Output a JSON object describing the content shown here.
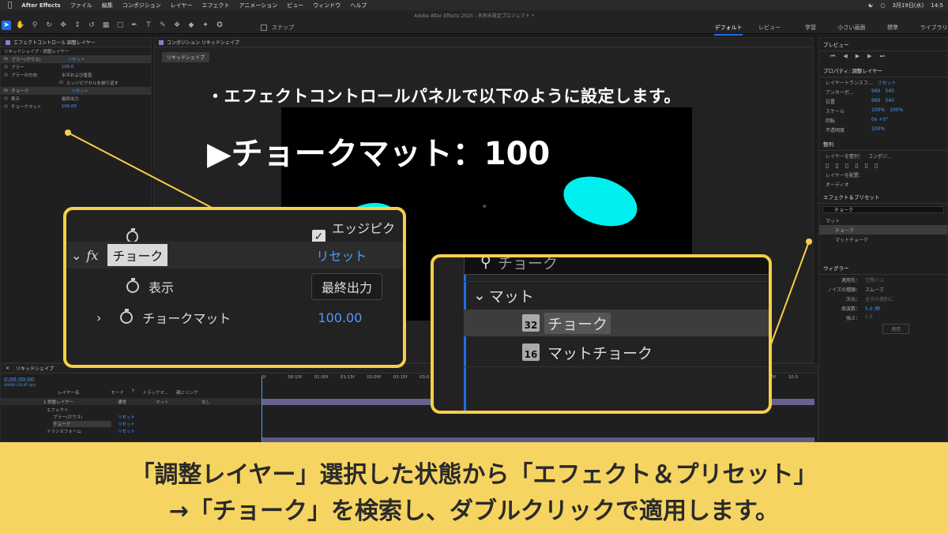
{
  "menubar": {
    "app": "After Effects",
    "items": [
      "ファイル",
      "編集",
      "コンポジション",
      "レイヤー",
      "エフェクト",
      "アニメーション",
      "ビュー",
      "ウィンドウ",
      "ヘルプ"
    ],
    "date": "3月19日(水)",
    "time": "14:5"
  },
  "window_title": "Adobe After Effects 2025 - 名称未設定プロジェクト *",
  "snap_label": "スナップ",
  "workspaces": [
    "デフォルト",
    "レビュー",
    "学習",
    "小さい画面",
    "標準",
    "ライブラリ"
  ],
  "effect_controls": {
    "tab": "エフェクトコントロール 調整レイヤー",
    "path": "リキッドシェイプ・調整レイヤー",
    "rows": [
      {
        "label": "ブラー(ガウス)",
        "value": "リセット"
      },
      {
        "label": "ブラー",
        "value": "100.0"
      },
      {
        "label": "ブラーの方向",
        "value": "水平および垂直"
      },
      {
        "label": "エッジピクセルを繰り返す",
        "value": ""
      },
      {
        "label": "チョーク",
        "value": "リセット"
      },
      {
        "label": "表示",
        "value": "最終出力"
      },
      {
        "label": "チョークマット",
        "value": "100.00"
      }
    ]
  },
  "composition": {
    "tab": "コンポジション リキッドシェイプ",
    "chip": "リキッドシェイプ"
  },
  "captions": {
    "top": "・エフェクトコントロールパネルで以下のように設定します。",
    "main": "▶チョークマット：100"
  },
  "zoom_effects": {
    "edge_pixels": "エッジピクセ",
    "fx": "fx",
    "choke": "チョーク",
    "reset": "リセット",
    "view": "表示",
    "view_value": "最終出力",
    "choke_matte": "チョークマット",
    "choke_matte_value": "100.00"
  },
  "zoom_presets": {
    "search": "チョーク",
    "group": "マット",
    "item1_badge": "32",
    "item1": "チョーク",
    "item2_badge": "16",
    "item2": "マットチョーク"
  },
  "right_panel": {
    "preview_title": "プレビュー",
    "props_title": "プロパティ: 調整レイヤー",
    "layer_transform": "レイヤートランスフ...",
    "reset": "リセット",
    "props": [
      {
        "label": "アンカーポ...",
        "v1": "960",
        "v2": "540"
      },
      {
        "label": "位置",
        "v1": "960",
        "v2": "540"
      },
      {
        "label": "スケール",
        "v1": "100%",
        "v2": "100%"
      },
      {
        "label": "回転",
        "v1": "0x +0°",
        "v2": ""
      },
      {
        "label": "不透明度",
        "v1": "100%",
        "v2": ""
      }
    ],
    "align_title": "整列",
    "align_to": "レイヤーを整列：",
    "align_to_value": "コンポジ...",
    "distribute": "レイヤーを配置：",
    "distribute_value": "オーディオ",
    "effects_title": "エフェクト＆プリセット",
    "search": "チョーク",
    "tree_group": "マット",
    "tree_item1": "チョーク",
    "tree_item2": "マットチョーク",
    "wiggler_title": "ウィグラー",
    "wiggler_rows": [
      {
        "label": "適用先：",
        "value": "空間パス"
      },
      {
        "label": "ノイズの種類：",
        "value": "スムーズ"
      },
      {
        "label": "次元：",
        "value": "全次元個別に"
      },
      {
        "label": "周波数：",
        "value": "5.0 /秒"
      },
      {
        "label": "強さ：",
        "value": "1.0"
      }
    ],
    "apply": "適用"
  },
  "timeline": {
    "tab": "リキッドシェイプ",
    "timecode": "0;00;00;00",
    "timecode_sub": "00000 (29.97 fps)",
    "cols": [
      "レイヤー名",
      "モード",
      "T",
      "トラックマ...",
      "親とリンク"
    ],
    "ruler": [
      "0f",
      "00:15f",
      "01:00f",
      "01:15f",
      "02:00f",
      "02:15f",
      "03:0",
      "09:15f",
      "10:0"
    ],
    "rows": [
      {
        "name": "1  調整レイヤー",
        "mode": "通常",
        "track": "マット",
        "parent": "なし"
      },
      {
        "name": "エフェクト",
        "mode": "",
        "track": "",
        "parent": ""
      },
      {
        "name": "ブラー(ガウス)",
        "mode": "リセット",
        "track": "",
        "parent": ""
      },
      {
        "name": "チョーク",
        "mode": "リセット",
        "track": "",
        "parent": ""
      },
      {
        "name": "トランスフォーム",
        "mode": "リセット",
        "track": "",
        "parent": ""
      }
    ]
  },
  "banner": {
    "line1": "「調整レイヤー」選択した状態から「エフェクト＆プリセット」",
    "line2": "→「チョーク」を検索し、ダブルクリックで適用します。"
  },
  "colors": {
    "highlight": "#f6cf48",
    "banner": "#f6d461",
    "accent_blue": "#4a9bff",
    "shape_cyan": "#00f0f0"
  }
}
